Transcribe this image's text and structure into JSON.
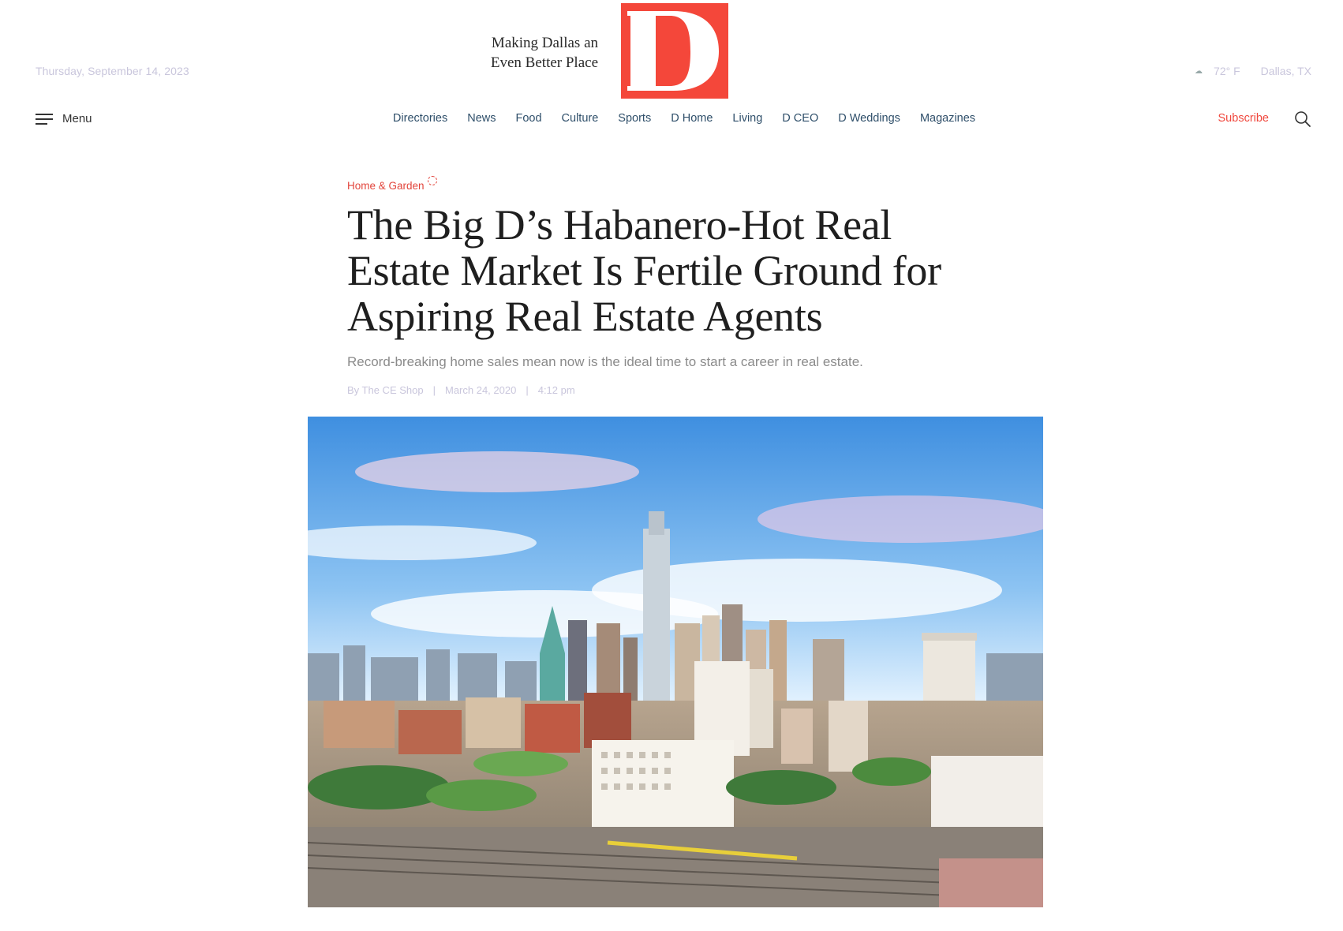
{
  "header": {
    "date": "Thursday, September 14, 2023",
    "tagline_line1": "Making Dallas an",
    "tagline_line2": "Even Better Place",
    "logo_letter": "D",
    "logo_color": "#f4473a",
    "weather_icon": "weather-icon",
    "temperature": "72° F",
    "location": "Dallas, TX"
  },
  "nav": {
    "menu_label": "Menu",
    "items": [
      "Directories",
      "News",
      "Food",
      "Culture",
      "Sports",
      "D Home",
      "Living",
      "D CEO",
      "D Weddings",
      "Magazines"
    ],
    "subscribe_label": "Subscribe",
    "search_icon": "search-icon"
  },
  "article": {
    "category": "Home & Garden",
    "headline": "The Big D’s Habanero-Hot Real Estate Market Is Fertile Ground for Aspiring Real Estate Agents",
    "dek": "Record-breaking home sales mean now is the ideal time to start a career in real estate.",
    "author": "By The CE Shop",
    "date": "March 24, 2020",
    "time": "4:12 pm"
  },
  "colors": {
    "accent": "#f4473a",
    "nav_text": "#2f4f6a",
    "muted": "#c9c6dc"
  }
}
